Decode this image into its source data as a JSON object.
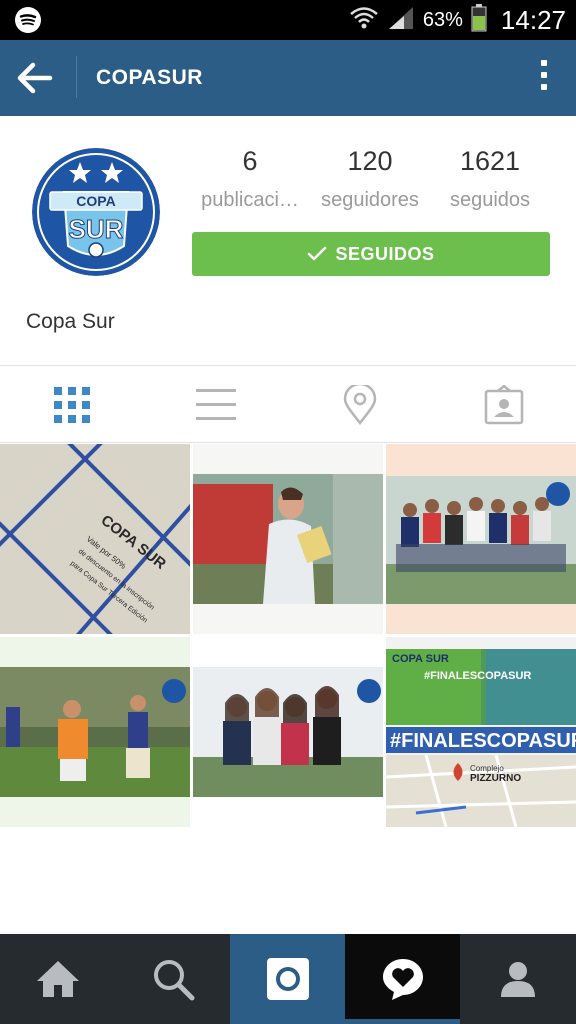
{
  "status_bar": {
    "battery_percent": "63%",
    "time": "14:27",
    "icons": [
      "spotify-icon",
      "wifi-icon",
      "cell-signal-icon",
      "battery-icon"
    ]
  },
  "action_bar": {
    "title": "COPASUR",
    "back_icon": "back-arrow-icon",
    "menu_icon": "overflow-menu-icon"
  },
  "profile": {
    "avatar_text": {
      "line1": "COPA",
      "line2": "SUR"
    },
    "stats": [
      {
        "value": "6",
        "label": "publicaci…"
      },
      {
        "value": "120",
        "label": "seguidores"
      },
      {
        "value": "1621",
        "label": "seguidos"
      }
    ],
    "follow_button": "SEGUIDOS",
    "name": "Copa Sur"
  },
  "tabs": [
    {
      "icon": "grid-icon",
      "active": true
    },
    {
      "icon": "list-icon",
      "active": false
    },
    {
      "icon": "location-pin-icon",
      "active": false
    },
    {
      "icon": "tagged-photos-icon",
      "active": false
    }
  ],
  "grid": {
    "post1_lines": [
      "COPA SUR",
      "Vale por 50%",
      "de descuento en la inscripción",
      "para Copa Sur Tercera Edición"
    ],
    "post6_header": "COPA SUR",
    "post6_tag_top": "#FINALESCOPASUR",
    "post6_tag_mid": "#FINALESCOPASUR",
    "post6_map_label": "Complejo",
    "post6_map_name": "PIZZURNO"
  },
  "bottom_nav": [
    {
      "icon": "home-icon"
    },
    {
      "icon": "search-icon"
    },
    {
      "icon": "camera-icon"
    },
    {
      "icon": "news-heart-icon",
      "active": true
    },
    {
      "icon": "profile-icon"
    }
  ],
  "colors": {
    "header_blue": "#2b5d87",
    "follow_green": "#6cbf4c",
    "nav_dark": "#262b30",
    "tab_active": "#3d88c8"
  }
}
